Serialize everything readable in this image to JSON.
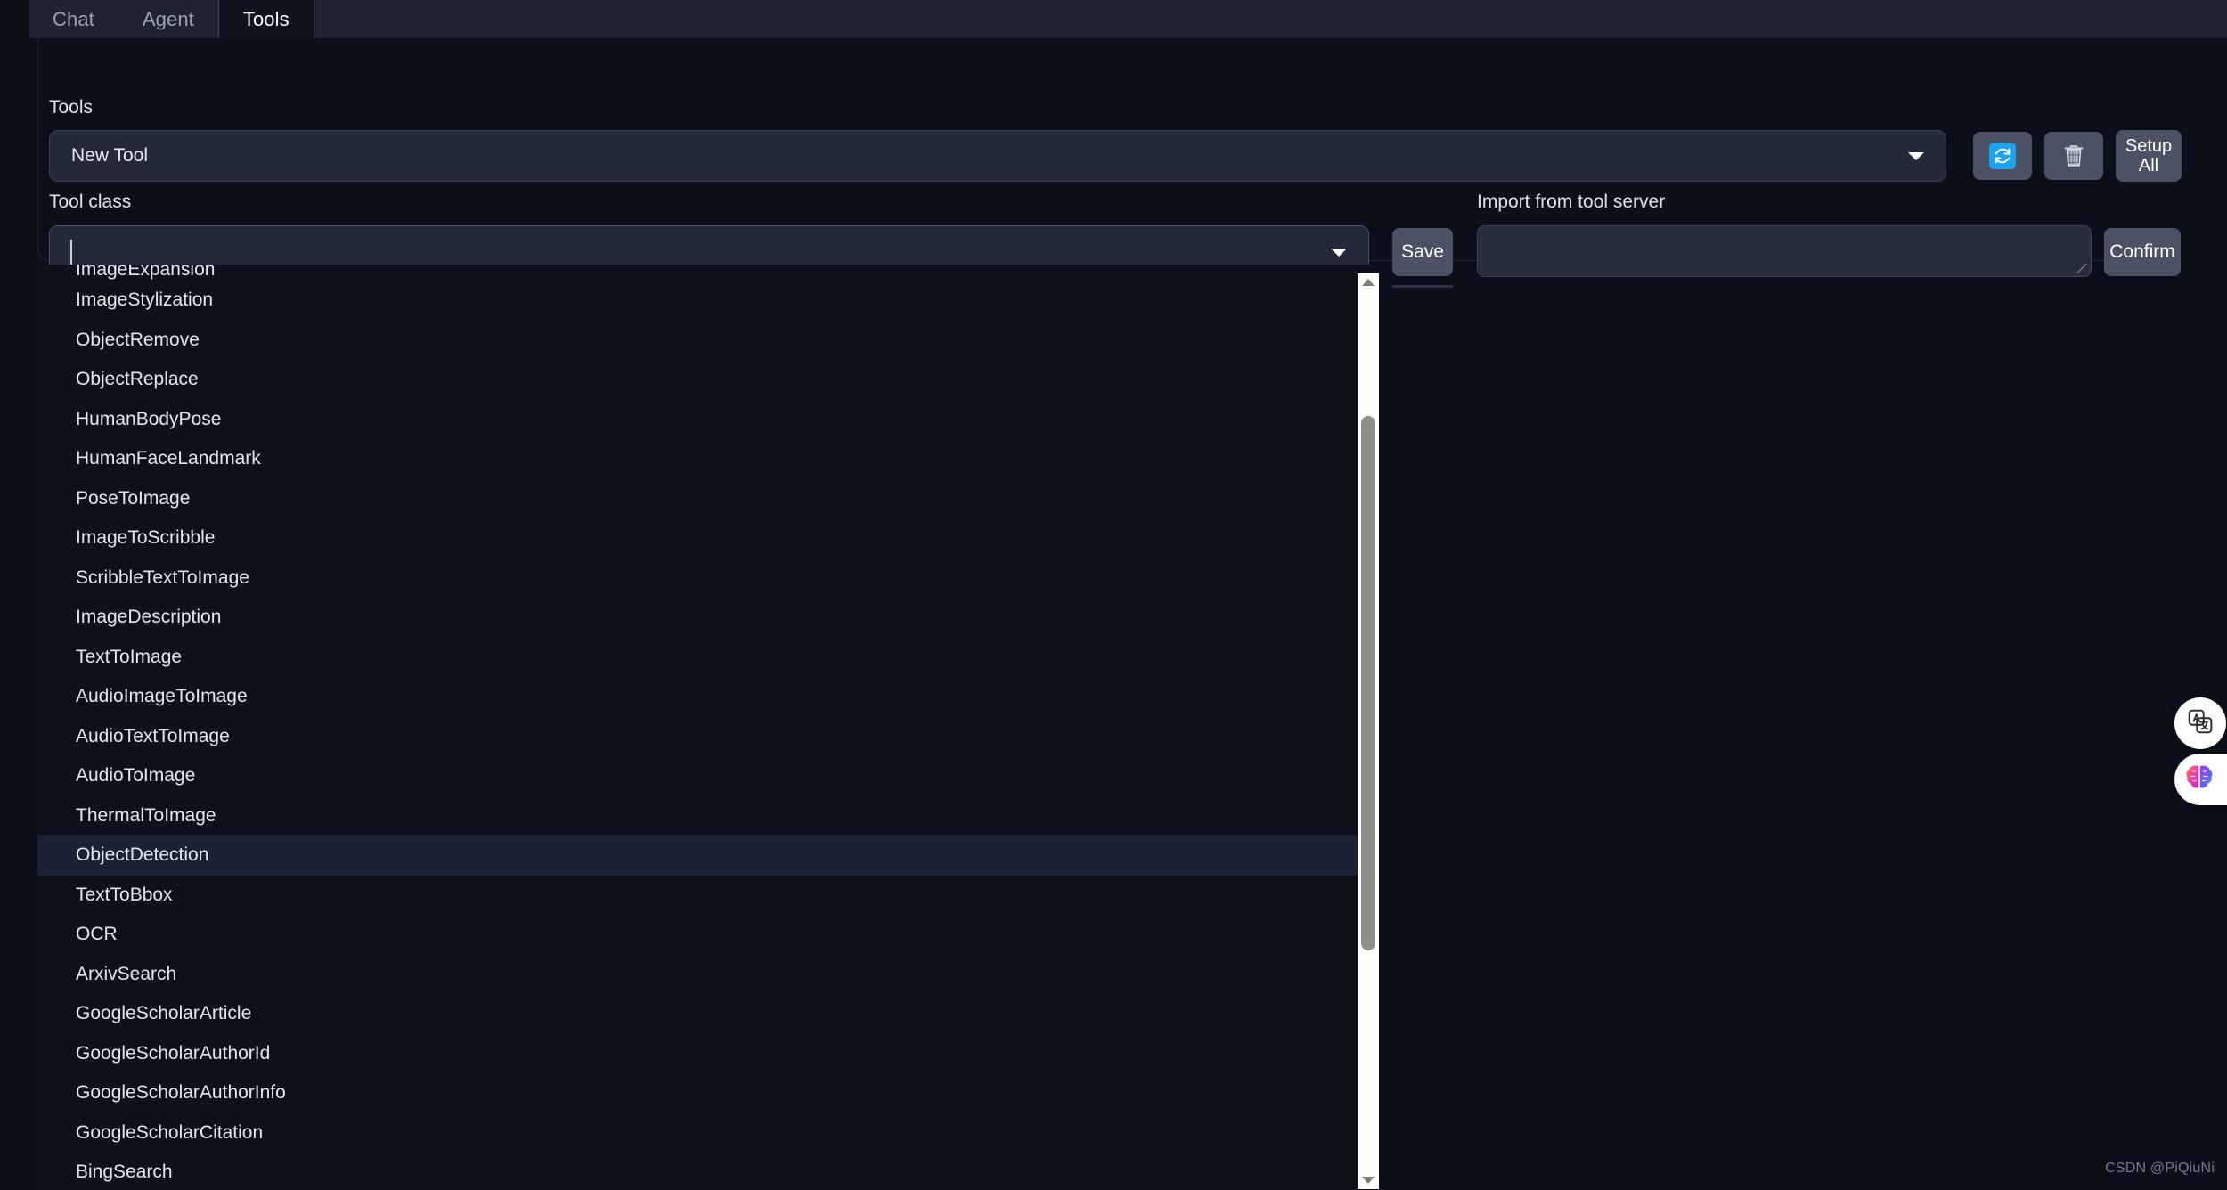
{
  "tabs": [
    {
      "label": "Chat",
      "active": false
    },
    {
      "label": "Agent",
      "active": false
    },
    {
      "label": "Tools",
      "active": true
    }
  ],
  "colors": {
    "page_bg": "#0b0f19",
    "tabbar_bg": "#1f2330",
    "field_bg": "#232939",
    "button_bg": "#4b5263",
    "accent_blue": "#1aa3f0",
    "selected_row": "#1b2233",
    "scrollbar_track": "#ffffff",
    "scrollbar_thumb": "#8e8e8e"
  },
  "form": {
    "tools_label": "Tools",
    "tools_selected": "New Tool",
    "tool_class_label": "Tool class",
    "tool_class_value": "",
    "import_label": "Import from tool server",
    "import_value": "",
    "import_placeholder": ""
  },
  "buttons": {
    "refresh_icon": "refresh-icon",
    "delete_icon": "trash-icon",
    "setup_all_line1": "Setup",
    "setup_all_line2": "All",
    "save_label": "Save",
    "confirm_label": "Confirm"
  },
  "dropdown": {
    "clipped_top_item": "ImageExpansion",
    "selected_item": "ObjectDetection",
    "items": [
      "ImageStylization",
      "ObjectRemove",
      "ObjectReplace",
      "HumanBodyPose",
      "HumanFaceLandmark",
      "PoseToImage",
      "ImageToScribble",
      "ScribbleTextToImage",
      "ImageDescription",
      "TextToImage",
      "AudioImageToImage",
      "AudioTextToImage",
      "AudioToImage",
      "ThermalToImage",
      "ObjectDetection",
      "TextToBbox",
      "OCR",
      "ArxivSearch",
      "GoogleScholarArticle",
      "GoogleScholarAuthorId",
      "GoogleScholarAuthorInfo",
      "GoogleScholarCitation",
      "BingSearch"
    ]
  },
  "floating_buttons": [
    {
      "name": "translate-icon"
    },
    {
      "name": "brain-icon"
    }
  ],
  "watermark": "CSDN @PiQiuNi"
}
